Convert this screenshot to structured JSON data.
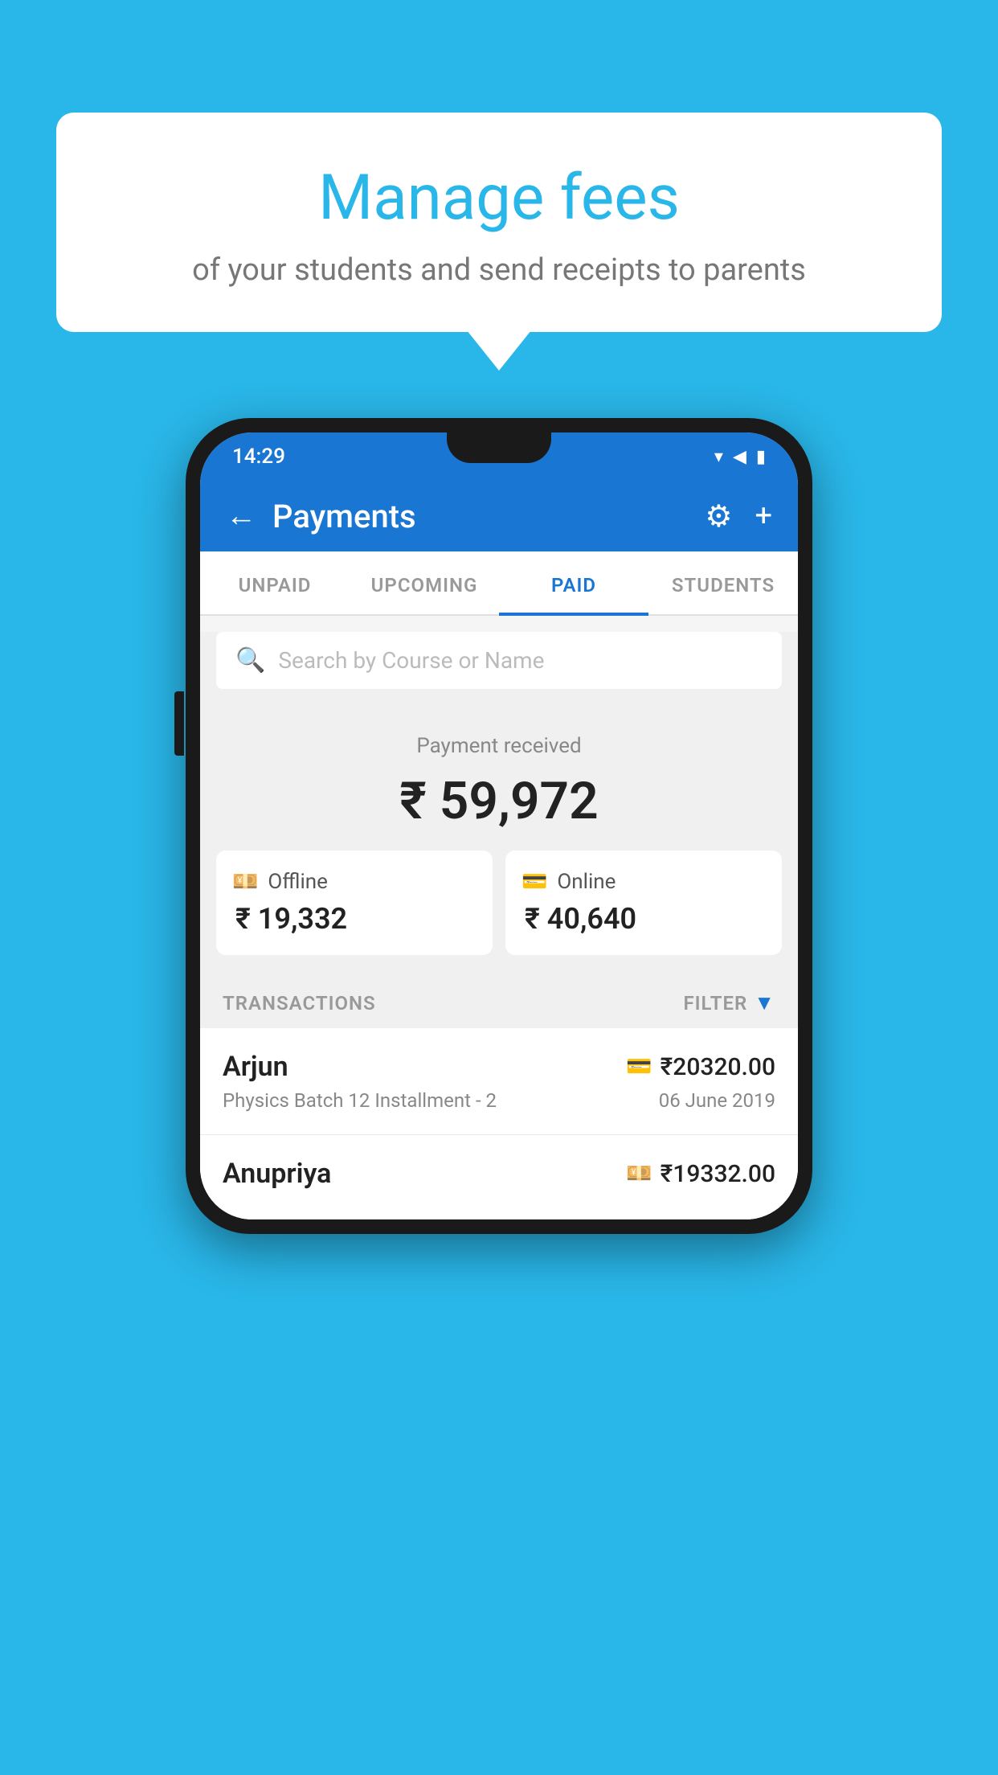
{
  "background_color": "#29b6e8",
  "bubble": {
    "title": "Manage fees",
    "subtitle": "of your students and send receipts to parents"
  },
  "status_bar": {
    "time": "14:29",
    "wifi_icon": "▾",
    "signal_icon": "▾",
    "battery_icon": "▮"
  },
  "app_bar": {
    "title": "Payments",
    "back_label": "←",
    "settings_label": "⚙",
    "add_label": "+"
  },
  "tabs": [
    {
      "label": "UNPAID",
      "active": false
    },
    {
      "label": "UPCOMING",
      "active": false
    },
    {
      "label": "PAID",
      "active": true
    },
    {
      "label": "STUDENTS",
      "active": false
    }
  ],
  "search": {
    "placeholder": "Search by Course or Name"
  },
  "payment_received": {
    "label": "Payment received",
    "amount": "₹ 59,972"
  },
  "cards": [
    {
      "type": "Offline",
      "amount": "₹ 19,332",
      "icon": "💳"
    },
    {
      "type": "Online",
      "amount": "₹ 40,640",
      "icon": "💳"
    }
  ],
  "transactions_label": "TRANSACTIONS",
  "filter_label": "FILTER",
  "transactions": [
    {
      "name": "Arjun",
      "amount": "₹20320.00",
      "course": "Physics Batch 12 Installment - 2",
      "date": "06 June 2019",
      "payment_type": "online"
    },
    {
      "name": "Anupriya",
      "amount": "₹19332.00",
      "course": "",
      "date": "",
      "payment_type": "offline"
    }
  ]
}
